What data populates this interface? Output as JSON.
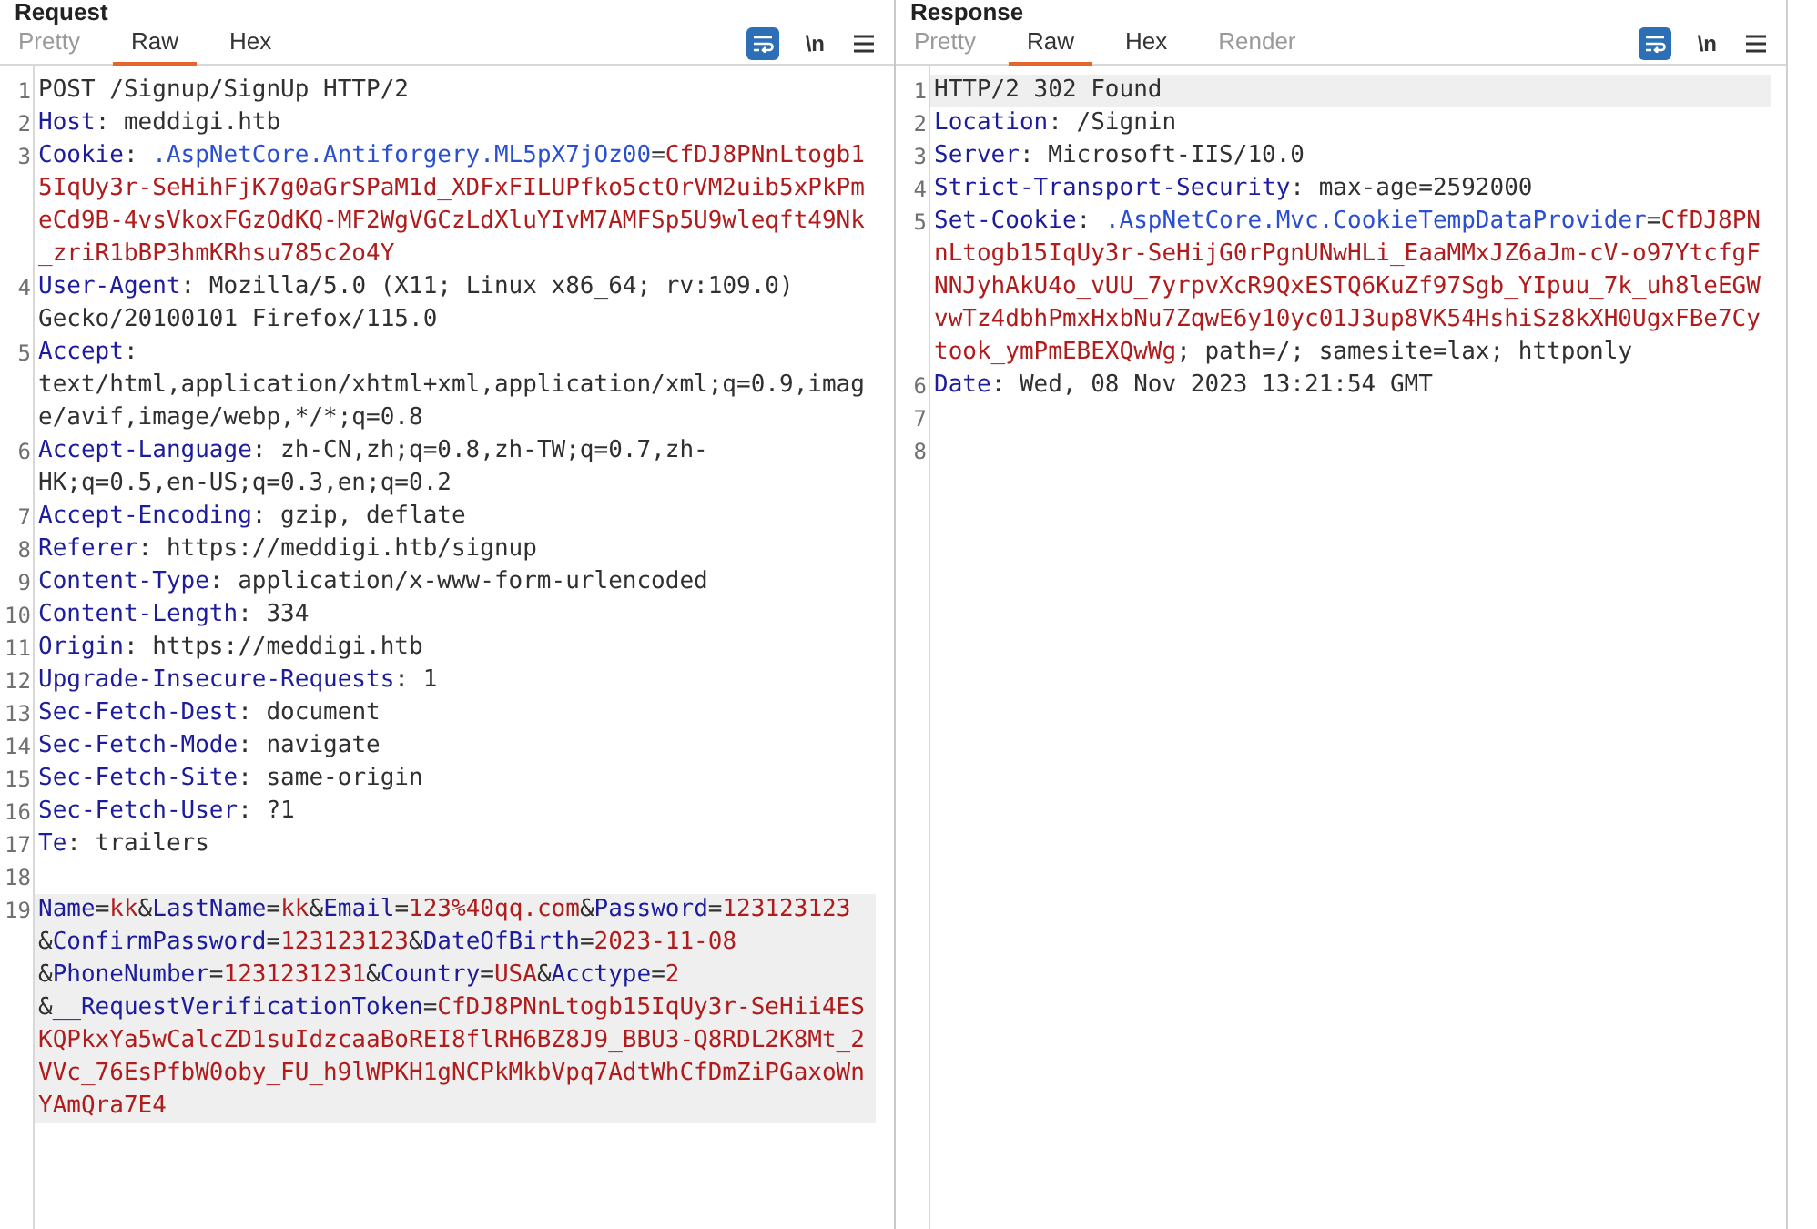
{
  "panes": [
    {
      "title": "Request",
      "tabs": [
        {
          "label": "Pretty",
          "selected": false,
          "disabled": true
        },
        {
          "label": "Raw",
          "selected": true,
          "disabled": false
        },
        {
          "label": "Hex",
          "selected": false,
          "disabled": false
        }
      ],
      "toolbar": [
        {
          "kind": "wrap",
          "selected": true
        },
        {
          "kind": "text",
          "label": "\\n",
          "selected": false
        },
        {
          "kind": "menu",
          "selected": false
        }
      ],
      "lines": [
        {
          "number": "1",
          "current": false,
          "segments": [
            {
              "kind": "value",
              "text": "POST /Signup/SignUp HTTP/2"
            }
          ]
        },
        {
          "number": "2",
          "current": false,
          "segments": [
            {
              "kind": "name",
              "text": "Host"
            },
            {
              "kind": "value",
              "text": ": meddigi.htb"
            }
          ]
        },
        {
          "number": "3",
          "current": false,
          "segments": [
            {
              "kind": "name",
              "text": "Cookie"
            },
            {
              "kind": "value",
              "text": ": "
            },
            {
              "kind": "cookie_name",
              "text": ".AspNetCore.Antiforgery.ML5pX7jOz00"
            },
            {
              "kind": "value",
              "text": "="
            },
            {
              "kind": "cookie_value",
              "text": "CfDJ8PNnLtogb15IqUy3r-SeHihFjK7g0aGrSPaM1d_XDFxFILUPfko5ctOrVM2uib5xPkPmeCd9B-4vsVkoxFGzOdKQ-MF2WgVGCzLdXluYIvM7AMFSp5U9wleqft49Nk_zriR1bBP3hmKRhsu785c2o4Y"
            }
          ]
        },
        {
          "number": "4",
          "current": false,
          "segments": [
            {
              "kind": "name",
              "text": "User-Agent"
            },
            {
              "kind": "value",
              "text": ": Mozilla/5.0 (X11; Linux x86_64; rv:109.0) Gecko/20100101 Firefox/115.0"
            }
          ]
        },
        {
          "number": "5",
          "current": false,
          "segments": [
            {
              "kind": "name",
              "text": "Accept"
            },
            {
              "kind": "value",
              "text": ": text/html,application/xhtml+xml,application/xml;q=0.9,image/avif,image/webp,*/*;q=0.8"
            }
          ]
        },
        {
          "number": "6",
          "current": false,
          "segments": [
            {
              "kind": "name",
              "text": "Accept-Language"
            },
            {
              "kind": "value",
              "text": ": zh-CN,zh;q=0.8,zh-TW;q=0.7,zh-HK;q=0.5,en-US;q=0.3,en;q=0.2"
            }
          ]
        },
        {
          "number": "7",
          "current": false,
          "segments": [
            {
              "kind": "name",
              "text": "Accept-Encoding"
            },
            {
              "kind": "value",
              "text": ": gzip, deflate"
            }
          ]
        },
        {
          "number": "8",
          "current": false,
          "segments": [
            {
              "kind": "name",
              "text": "Referer"
            },
            {
              "kind": "value",
              "text": ": https://meddigi.htb/signup"
            }
          ]
        },
        {
          "number": "9",
          "current": false,
          "segments": [
            {
              "kind": "name",
              "text": "Content-Type"
            },
            {
              "kind": "value",
              "text": ": application/x-www-form-urlencoded"
            }
          ]
        },
        {
          "number": "10",
          "current": false,
          "segments": [
            {
              "kind": "name",
              "text": "Content-Length"
            },
            {
              "kind": "value",
              "text": ": 334"
            }
          ]
        },
        {
          "number": "11",
          "current": false,
          "segments": [
            {
              "kind": "name",
              "text": "Origin"
            },
            {
              "kind": "value",
              "text": ": https://meddigi.htb"
            }
          ]
        },
        {
          "number": "12",
          "current": false,
          "segments": [
            {
              "kind": "name",
              "text": "Upgrade-Insecure-Requests"
            },
            {
              "kind": "value",
              "text": ": 1"
            }
          ]
        },
        {
          "number": "13",
          "current": false,
          "segments": [
            {
              "kind": "name",
              "text": "Sec-Fetch-Dest"
            },
            {
              "kind": "value",
              "text": ": document"
            }
          ]
        },
        {
          "number": "14",
          "current": false,
          "segments": [
            {
              "kind": "name",
              "text": "Sec-Fetch-Mode"
            },
            {
              "kind": "value",
              "text": ": navigate"
            }
          ]
        },
        {
          "number": "15",
          "current": false,
          "segments": [
            {
              "kind": "name",
              "text": "Sec-Fetch-Site"
            },
            {
              "kind": "value",
              "text": ": same-origin"
            }
          ]
        },
        {
          "number": "16",
          "current": false,
          "segments": [
            {
              "kind": "name",
              "text": "Sec-Fetch-User"
            },
            {
              "kind": "value",
              "text": ": ?1"
            }
          ]
        },
        {
          "number": "17",
          "current": false,
          "segments": [
            {
              "kind": "name",
              "text": "Te"
            },
            {
              "kind": "value",
              "text": ": trailers"
            }
          ]
        },
        {
          "number": "18",
          "current": false
        },
        {
          "number": "19",
          "current": true,
          "segments": [
            {
              "kind": "name",
              "text": "Name"
            },
            {
              "kind": "value",
              "text": "="
            },
            {
              "kind": "cookie_value",
              "text": "kk"
            },
            {
              "kind": "value",
              "text": "&"
            },
            {
              "kind": "name",
              "text": "LastName"
            },
            {
              "kind": "value",
              "text": "="
            },
            {
              "kind": "cookie_value",
              "text": "kk"
            },
            {
              "kind": "value",
              "text": "&"
            },
            {
              "kind": "name",
              "text": "Email"
            },
            {
              "kind": "value",
              "text": "="
            },
            {
              "kind": "cookie_value",
              "text": "123%40qq.com"
            },
            {
              "kind": "value",
              "text": "&"
            },
            {
              "kind": "name",
              "text": "Password"
            },
            {
              "kind": "value",
              "text": "="
            },
            {
              "kind": "cookie_value",
              "text": "123123123"
            },
            {
              "kind": "value",
              "text": "&"
            },
            {
              "kind": "name",
              "text": "ConfirmPassword"
            },
            {
              "kind": "value",
              "text": "="
            },
            {
              "kind": "cookie_value",
              "text": "123123123"
            },
            {
              "kind": "value",
              "text": "&"
            },
            {
              "kind": "name",
              "text": "DateOfBirth"
            },
            {
              "kind": "value",
              "text": "="
            },
            {
              "kind": "cookie_value",
              "text": "2023-11-08"
            },
            {
              "kind": "value",
              "text": "&"
            },
            {
              "kind": "name",
              "text": "PhoneNumber"
            },
            {
              "kind": "value",
              "text": "="
            },
            {
              "kind": "cookie_value",
              "text": "1231231231"
            },
            {
              "kind": "value",
              "text": "&"
            },
            {
              "kind": "name",
              "text": "Country"
            },
            {
              "kind": "value",
              "text": "="
            },
            {
              "kind": "cookie_value",
              "text": "USA"
            },
            {
              "kind": "value",
              "text": "&"
            },
            {
              "kind": "name",
              "text": "Acctype"
            },
            {
              "kind": "value",
              "text": "="
            },
            {
              "kind": "cookie_value",
              "text": "2"
            },
            {
              "kind": "value",
              "text": "&"
            },
            {
              "kind": "name",
              "text": "__RequestVerificationToken"
            },
            {
              "kind": "value",
              "text": "="
            },
            {
              "kind": "cookie_value",
              "text": "CfDJ8PNnLtogb15IqUy3r-SeHii4ESKQPkxYa5wCalcZD1suIdzcaaBoREI8flRH6BZ8J9_BBU3-Q8RDL2K8Mt_2VVc_76EsPfbW0oby_FU_h9lWPKH1gNCPkMkbVpq7AdtWhCfDmZiPGaxoWnYAmQra7E4"
            }
          ]
        }
      ]
    },
    {
      "title": "Response",
      "tabs": [
        {
          "label": "Pretty",
          "selected": false,
          "disabled": true
        },
        {
          "label": "Raw",
          "selected": true,
          "disabled": false
        },
        {
          "label": "Hex",
          "selected": false,
          "disabled": false
        },
        {
          "label": "Render",
          "selected": false,
          "disabled": true
        }
      ],
      "toolbar": [
        {
          "kind": "wrap",
          "selected": true
        },
        {
          "kind": "text",
          "label": "\\n",
          "selected": false
        },
        {
          "kind": "menu",
          "selected": false
        }
      ],
      "lines": [
        {
          "number": "1",
          "current": true,
          "segments": [
            {
              "kind": "value",
              "text": "HTTP/2 302 Found"
            }
          ]
        },
        {
          "number": "2",
          "current": false,
          "segments": [
            {
              "kind": "name",
              "text": "Location"
            },
            {
              "kind": "value",
              "text": ": /Signin"
            }
          ]
        },
        {
          "number": "3",
          "current": false,
          "segments": [
            {
              "kind": "name",
              "text": "Server"
            },
            {
              "kind": "value",
              "text": ": Microsoft-IIS/10.0"
            }
          ]
        },
        {
          "number": "4",
          "current": false,
          "segments": [
            {
              "kind": "name",
              "text": "Strict-Transport-Security"
            },
            {
              "kind": "value",
              "text": ": max-age=2592000"
            }
          ]
        },
        {
          "number": "5",
          "current": false,
          "segments": [
            {
              "kind": "name",
              "text": "Set-Cookie"
            },
            {
              "kind": "value",
              "text": ": "
            },
            {
              "kind": "cookie_name",
              "text": ".AspNetCore.Mvc.CookieTempDataProvider"
            },
            {
              "kind": "value",
              "text": "="
            },
            {
              "kind": "cookie_value",
              "text": "CfDJ8PNnLtogb15IqUy3r-SeHijG0rPgnUNwHLi_EaaMMxJZ6aJm-cV-o97YtcfgFNNJyhAkU4o_vUU_7yrpvXcR9QxESTQ6KuZf97Sgb_YIpuu_7k_uh8leEGWvwTz4dbhPmxHxbNu7ZqwE6y10yc01J3up8VK54HshiSz8kXH0UgxFBe7Cytook_ymPmEBEXQwWg"
            },
            {
              "kind": "value",
              "text": "; path=/; samesite=lax; httponly"
            }
          ]
        },
        {
          "number": "6",
          "current": false,
          "segments": [
            {
              "kind": "name",
              "text": "Date"
            },
            {
              "kind": "value",
              "text": ": Wed, 08 Nov 2023 13:21:54 GMT"
            }
          ]
        },
        {
          "number": "7",
          "current": false
        },
        {
          "number": "8",
          "current": false
        }
      ]
    }
  ]
}
